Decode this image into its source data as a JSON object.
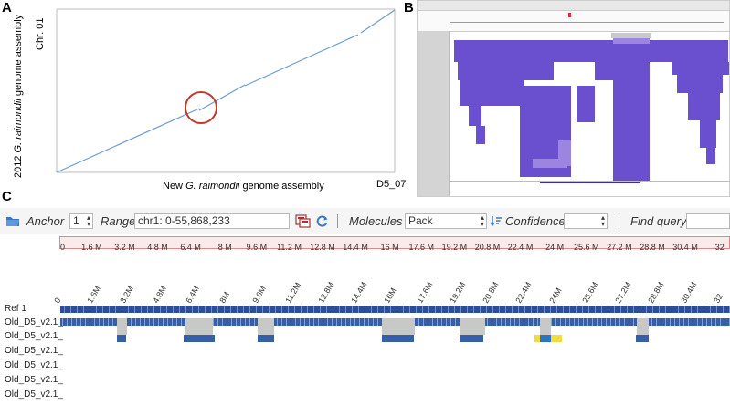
{
  "panels": {
    "a": "A",
    "b": "B",
    "c": "C"
  },
  "panel_a": {
    "y_label_prefix": "2012",
    "y_label_italic": "G. raimondii",
    "y_label_suffix": "genome assembly",
    "x_label_prefix": "New",
    "x_label_italic": "G. raimondii",
    "x_label_suffix": "genome assembly",
    "y_tick": "Chr. 01",
    "x_tick": "D5_07",
    "line_color": "#6d9cd0",
    "circle_color": "#c0392b"
  },
  "panel_c": {
    "toolbar": {
      "anchor_label": "Anchor",
      "anchor_value": "1",
      "range_label": "Range",
      "range_value": "chr1: 0-55,868,233",
      "molecules_label": "Molecules",
      "molecules_value": "Pack",
      "confidence_label": "Confidence",
      "confidence_value": "",
      "find_label": "Find query"
    },
    "ruler_ticks": [
      "0",
      "1.6 M",
      "3.2 M",
      "4.8 M",
      "6.4 M",
      "8 M",
      "9.6 M",
      "11.2 M",
      "12.8 M",
      "14.4 M",
      "16 M",
      "17.6 M",
      "19.2 M",
      "20.8 M",
      "22.4 M",
      "24 M",
      "25.6 M",
      "27.2 M",
      "28.8 M",
      "30.4 M",
      "32"
    ],
    "rotated_ticks": [
      "0",
      "1.6M",
      "3.2M",
      "4.8M",
      "6.4M",
      "8M",
      "9.6M",
      "11.2M",
      "12.8M",
      "14.4M",
      "16M",
      "17.6M",
      "19.2M",
      "20.8M",
      "22.4M",
      "24M",
      "25.6M",
      "27.2M",
      "28.8M",
      "30.4M",
      "32"
    ],
    "track_labels": [
      "Ref 1",
      "Old_D5_v2.1_",
      "Old_D5_v2.1_",
      "Old_D5_v2.1_",
      "Old_D5_v2.1_",
      "Old_D5_v2.1_",
      "Old_D5_v2.1_"
    ],
    "colors": {
      "ref": "#2b4f96",
      "track": "#3560a8",
      "gap": "#c8c8c8",
      "highlight": "#f0dc3c",
      "accent": "#2d74c4"
    }
  }
}
